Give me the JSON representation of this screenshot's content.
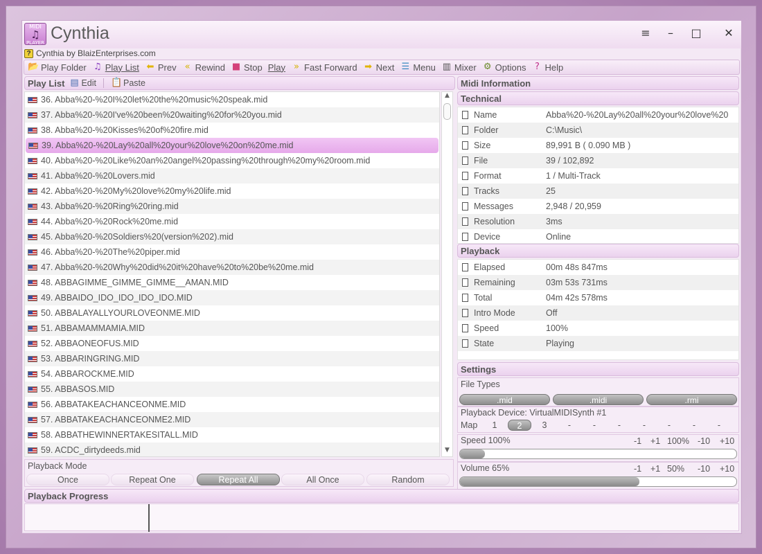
{
  "app": {
    "title": "Cynthia",
    "icon_top": "MIDI",
    "icon_bottom": "PLAYER",
    "subtitle": "Cynthia by BlaizEnterprises.com"
  },
  "window_controls": {
    "menu": "≡",
    "minimize": "–",
    "maximize": "□",
    "close": "✕"
  },
  "toolbar": [
    {
      "name": "play-folder",
      "label": "Play Folder",
      "icon": "folder-icon",
      "glyph": "📂",
      "underline": false
    },
    {
      "name": "play-list",
      "label": "Play List",
      "icon": "music-note-icon",
      "glyph": "♫",
      "underline": true
    },
    {
      "name": "prev",
      "label": "Prev",
      "icon": "arrow-left-icon",
      "glyph": "⬅",
      "underline": false
    },
    {
      "name": "rewind",
      "label": "Rewind",
      "icon": "rewind-icon",
      "glyph": "«",
      "underline": false
    },
    {
      "name": "stop",
      "label": "Stop",
      "icon": "stop-icon",
      "glyph": "■",
      "underline": false
    },
    {
      "name": "play",
      "label": "Play",
      "icon": "play-icon",
      "glyph": "",
      "underline": true
    },
    {
      "name": "fast-forward",
      "label": "Fast Forward",
      "icon": "fast-forward-icon",
      "glyph": "»",
      "underline": false
    },
    {
      "name": "next",
      "label": "Next",
      "icon": "arrow-right-icon",
      "glyph": "➡",
      "underline": false
    },
    {
      "name": "menu",
      "label": "Menu",
      "icon": "menu-icon",
      "glyph": "☰",
      "underline": false
    },
    {
      "name": "mixer",
      "label": "Mixer",
      "icon": "mixer-icon",
      "glyph": "▥",
      "underline": false
    },
    {
      "name": "options",
      "label": "Options",
      "icon": "gear-icon",
      "glyph": "⚙",
      "underline": false
    },
    {
      "name": "help",
      "label": "Help",
      "icon": "help-icon",
      "glyph": "?",
      "underline": false
    }
  ],
  "playlist": {
    "title": "Play List",
    "edit_label": "Edit",
    "paste_label": "Paste",
    "selected_index": 3,
    "items": [
      "36. Abba%20-%20I%20let%20the%20music%20speak.mid",
      "37. Abba%20-%20I've%20been%20waiting%20for%20you.mid",
      "38. Abba%20-%20Kisses%20of%20fire.mid",
      "39. Abba%20-%20Lay%20all%20your%20love%20on%20me.mid",
      "40. Abba%20-%20Like%20an%20angel%20passing%20through%20my%20room.mid",
      "41. Abba%20-%20Lovers.mid",
      "42. Abba%20-%20My%20love%20my%20life.mid",
      "43. Abba%20-%20Ring%20ring.mid",
      "44. Abba%20-%20Rock%20me.mid",
      "45. Abba%20-%20Soldiers%20(version%202).mid",
      "46. Abba%20-%20The%20piper.mid",
      "47. Abba%20-%20Why%20did%20it%20have%20to%20be%20me.mid",
      "48. ABBAGIMME_GIMME_GIMME__AMAN.MID",
      "49. ABBAIDO_IDO_IDO_IDO_IDO.MID",
      "50. ABBALAYALLYOURLOVEONME.MID",
      "51. ABBAMAMMAMIA.MID",
      "52. ABBAONEOFUS.MID",
      "53. ABBARINGRING.MID",
      "54. ABBAROCKME.MID",
      "55. ABBASOS.MID",
      "56. ABBATAKEACHANCEONME.MID",
      "57. ABBATAKEACHANCEONME2.MID",
      "58. ABBATHEWINNERTAKESITALL.MID",
      "59. ACDC_dirtydeeds.mid"
    ]
  },
  "playback_mode": {
    "label": "Playback Mode",
    "options": [
      "Once",
      "Repeat One",
      "Repeat All",
      "All Once",
      "Random"
    ],
    "active": 2
  },
  "midi_info": {
    "title": "Midi Information",
    "technical_title": "Technical",
    "technical": [
      {
        "key": "Name",
        "value": "Abba%20-%20Lay%20all%20your%20love%20"
      },
      {
        "key": "Folder",
        "value": "C:\\Music\\"
      },
      {
        "key": "Size",
        "value": "89,991 B  ( 0.090 MB )"
      },
      {
        "key": "File",
        "value": "39 / 102,892"
      },
      {
        "key": "Format",
        "value": "1 / Multi-Track"
      },
      {
        "key": "Tracks",
        "value": "25"
      },
      {
        "key": "Messages",
        "value": "2,948 / 20,959"
      },
      {
        "key": "Resolution",
        "value": "3ms"
      },
      {
        "key": "Device",
        "value": "Online"
      }
    ],
    "playback_title": "Playback",
    "playback": [
      {
        "key": "Elapsed",
        "value": "00m 48s 847ms"
      },
      {
        "key": "Remaining",
        "value": "03m 53s 731ms"
      },
      {
        "key": "Total",
        "value": "04m 42s 578ms"
      },
      {
        "key": "Intro Mode",
        "value": "Off"
      },
      {
        "key": "Speed",
        "value": "100%"
      },
      {
        "key": "State",
        "value": "Playing"
      }
    ]
  },
  "settings": {
    "title": "Settings",
    "file_types_label": "File Types",
    "file_types": [
      ".mid",
      ".midi",
      ".rmi"
    ],
    "device_label": "Playback Device: VirtualMIDISynth #1",
    "map_label": "Map",
    "map_options": [
      "1",
      "2",
      "3",
      "-",
      "-",
      "-",
      "-",
      "-",
      "-",
      "-"
    ],
    "map_active": 1,
    "speed_label": "Speed 100%",
    "speed_adjust": [
      "-1",
      "+1",
      "100%",
      "-10",
      "+10"
    ],
    "speed_fraction": 0.09,
    "volume_label": "Volume 65%",
    "volume_adjust": [
      "-1",
      "+1",
      "50%",
      "-10",
      "+10"
    ],
    "volume_fraction": 0.65
  },
  "progress": {
    "title": "Playback Progress",
    "fraction": 0.173
  }
}
